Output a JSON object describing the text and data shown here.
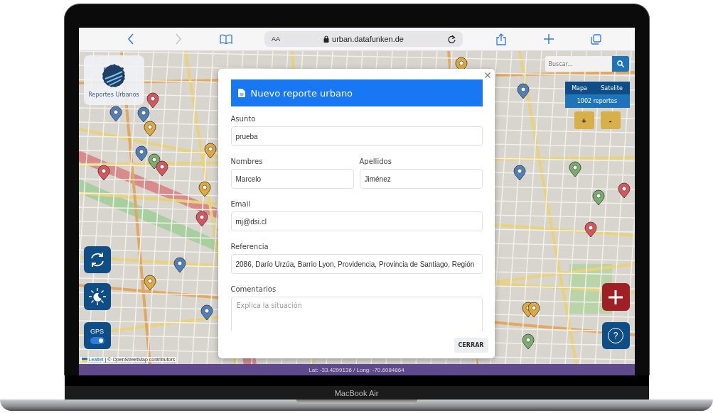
{
  "browser": {
    "text_size": "AA",
    "url": "urban.datafunken.de",
    "forward_disabled": true
  },
  "app": {
    "logo_label": "Reportes Urbanos",
    "search": {
      "placeholder": "Buscar..."
    },
    "layers": [
      "Mapa",
      "Satelite"
    ],
    "report_count": "1002 reportes",
    "zoom": [
      "+",
      "-"
    ],
    "gps": {
      "label": "GPS",
      "on": true
    },
    "help_label": "?",
    "attribution": {
      "link": "Leaflet",
      "text": "| © OpenStreetMap contributors"
    },
    "status_bar": "Lat: -33.4299136 / Long: -70.6084864"
  },
  "dialog": {
    "title": "Nuevo reporte urbano",
    "fields": [
      {
        "kind": "text",
        "label": "Asunto",
        "value": "prueba"
      },
      {
        "kind": "half",
        "label": "Nombres",
        "value": "Marcelo"
      },
      {
        "kind": "half",
        "label": "Apellidos",
        "value": "Jiménez"
      },
      {
        "kind": "text",
        "label": "Email",
        "value": "mj@dsi.cl"
      },
      {
        "kind": "text",
        "label": "Referencia",
        "value": "2086, Darío Urzúa, Barrio Lyon, Providencia, Provincia de Santiago, Región"
      },
      {
        "kind": "textarea",
        "label": "Comentarios",
        "placeholder": "Explica la situación"
      }
    ],
    "button": "CERRAR"
  },
  "device": {
    "label": "MacBook Air"
  }
}
